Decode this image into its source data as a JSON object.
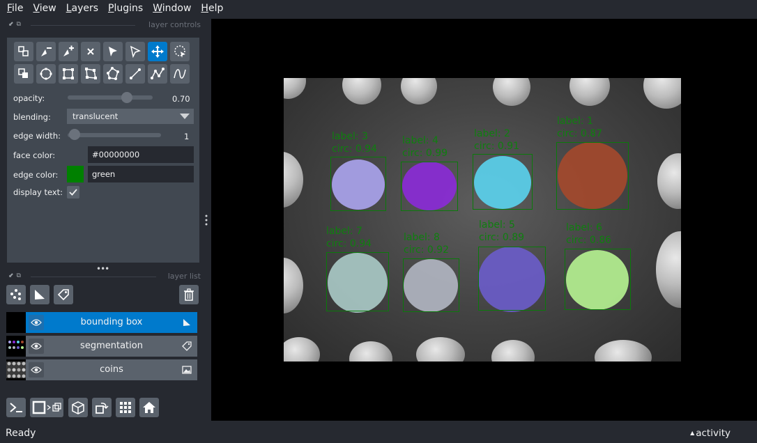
{
  "menu": [
    "File",
    "View",
    "Layers",
    "Plugins",
    "Window",
    "Help"
  ],
  "layer_controls": {
    "title": "layer controls",
    "opacity_label": "opacity:",
    "opacity_value": "0.70",
    "opacity_fraction": 0.7,
    "blending_label": "blending:",
    "blending_value": "translucent",
    "edge_width_label": "edge width:",
    "edge_width_value": "1",
    "face_color_label": "face color:",
    "face_color_value": "#00000000",
    "edge_color_label": "edge color:",
    "edge_color_value": "green",
    "edge_color_swatch": "#008000",
    "display_text_label": "display text:",
    "display_text_checked": true,
    "tools": [
      "select-vertices-icon",
      "remove-vertex-icon",
      "add-vertex-icon",
      "delete-shape-icon",
      "select-shapes-icon",
      "direct-select-icon",
      "pan-zoom-icon",
      "lasso-select-icon",
      "move-back-icon",
      "ellipse-icon",
      "rectangle-icon",
      "polygon-icon",
      "polygon-lasso-icon",
      "line-icon",
      "path-icon",
      "polyline-icon"
    ],
    "active_tool": "pan-zoom-icon"
  },
  "layer_list": {
    "title": "layer list",
    "layers": [
      {
        "name": "bounding box",
        "selected": true,
        "type_icon": "shapes-icon"
      },
      {
        "name": "segmentation",
        "selected": false,
        "type_icon": "labels-icon"
      },
      {
        "name": "coins",
        "selected": false,
        "type_icon": "image-icon"
      }
    ]
  },
  "annotations": [
    {
      "label": "label: 3",
      "circ": "circ: 0.94",
      "color": "#a9a3ec"
    },
    {
      "label": "label: 4",
      "circ": "circ: 0.99",
      "color": "#8a2bd6"
    },
    {
      "label": "label: 2",
      "circ": "circ: 0.91",
      "color": "#5ad0ec"
    },
    {
      "label": "label: 1",
      "circ": "circ: 0.87",
      "color": "#a3492c"
    },
    {
      "label": "label: 7",
      "circ": "circ: 0.94",
      "color": "#a8c8c4"
    },
    {
      "label": "label: 8",
      "circ": "circ: 0.92",
      "color": "#b0b4c0"
    },
    {
      "label": "label: 5",
      "circ": "circ: 0.89",
      "color": "#6a5cc8"
    },
    {
      "label": "label: 6",
      "circ": "circ: 0.86",
      "color": "#b4f090"
    }
  ],
  "status": {
    "text": "Ready",
    "activity": "activity"
  }
}
